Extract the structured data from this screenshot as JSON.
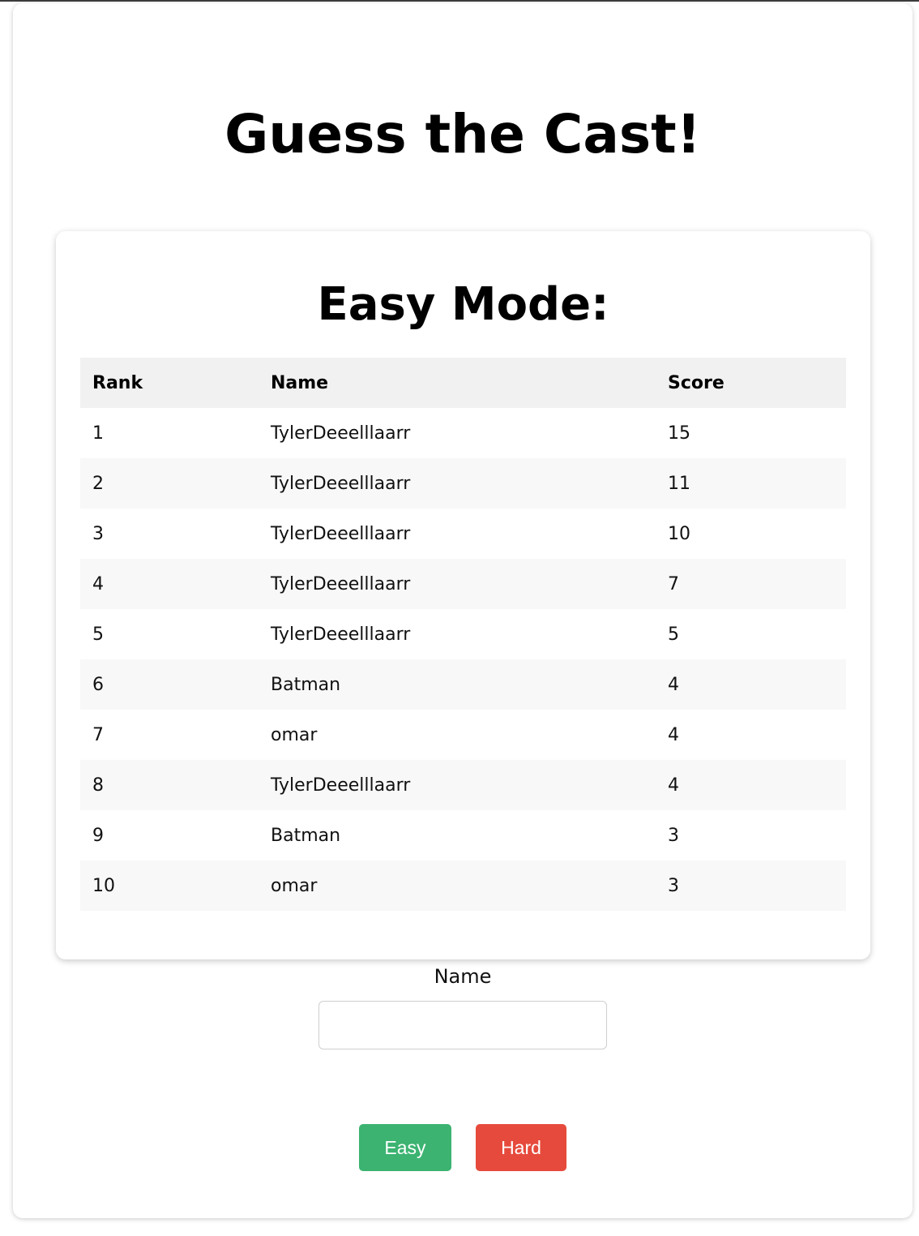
{
  "page": {
    "title": "Guess the Cast!"
  },
  "leaderboard": {
    "heading": "Easy Mode:",
    "columns": {
      "rank": "Rank",
      "name": "Name",
      "score": "Score"
    },
    "rows": [
      {
        "rank": "1",
        "name": "TylerDeeelllaarr",
        "score": "15"
      },
      {
        "rank": "2",
        "name": "TylerDeeelllaarr",
        "score": "11"
      },
      {
        "rank": "3",
        "name": "TylerDeeelllaarr",
        "score": "10"
      },
      {
        "rank": "4",
        "name": "TylerDeeelllaarr",
        "score": "7"
      },
      {
        "rank": "5",
        "name": "TylerDeeelllaarr",
        "score": "5"
      },
      {
        "rank": "6",
        "name": "Batman",
        "score": "4"
      },
      {
        "rank": "7",
        "name": "omar",
        "score": "4"
      },
      {
        "rank": "8",
        "name": "TylerDeeelllaarr",
        "score": "4"
      },
      {
        "rank": "9",
        "name": "Batman",
        "score": "3"
      },
      {
        "rank": "10",
        "name": "omar",
        "score": "3"
      }
    ]
  },
  "name_field": {
    "label": "Name",
    "value": ""
  },
  "buttons": {
    "easy_label": "Easy",
    "hard_label": "Hard"
  },
  "colors": {
    "easy_button": "#3cb371",
    "hard_button": "#e64a3c",
    "header_row": "#f1f1f1",
    "striped_row": "#f8f8f8"
  }
}
